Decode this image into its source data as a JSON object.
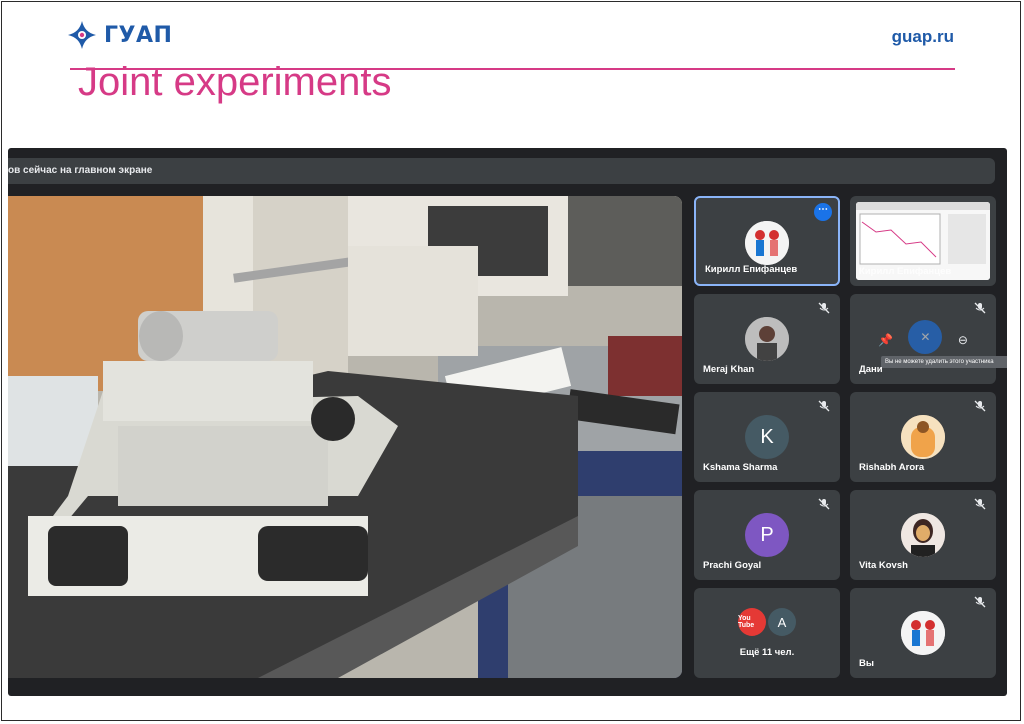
{
  "header": {
    "logo_text": "ГУАП",
    "site": "guap.ru",
    "title": "Joint experiments",
    "brand_color": "#1f5aa8",
    "accent_color": "#d63a86"
  },
  "meet": {
    "banner_text": "ов сейчас на главном экране",
    "main_video": "lab-microscope-video",
    "tiles": [
      {
        "name": "Кирилл Епифанцев",
        "active": true,
        "icon": "more-options-icon"
      },
      {
        "name": "Кирилл Епифанцев",
        "icon": "screen-share-thumbnail"
      },
      {
        "name": "Meraj Khan",
        "muted": true
      },
      {
        "name": "Дани",
        "muted": true,
        "tooltip": "Вы не можете удалить этого участника"
      },
      {
        "name": "Kshama Sharma",
        "letter": "K",
        "muted": true
      },
      {
        "name": "Rishabh Arora",
        "muted": true
      },
      {
        "name": "Prachi Goyal",
        "letter": "P",
        "muted": true
      },
      {
        "name": "Vita Kovsh",
        "muted": true
      },
      {
        "more": "Ещё 11 чел.",
        "letters": [
          "You Tube",
          "A"
        ]
      },
      {
        "name": "Вы",
        "muted": true
      }
    ],
    "colors": {
      "bg": "#202124",
      "tile": "#3c4043",
      "active": "#8ab4f8",
      "k_avatar": "#455a64",
      "p_avatar": "#7e57c2"
    }
  }
}
